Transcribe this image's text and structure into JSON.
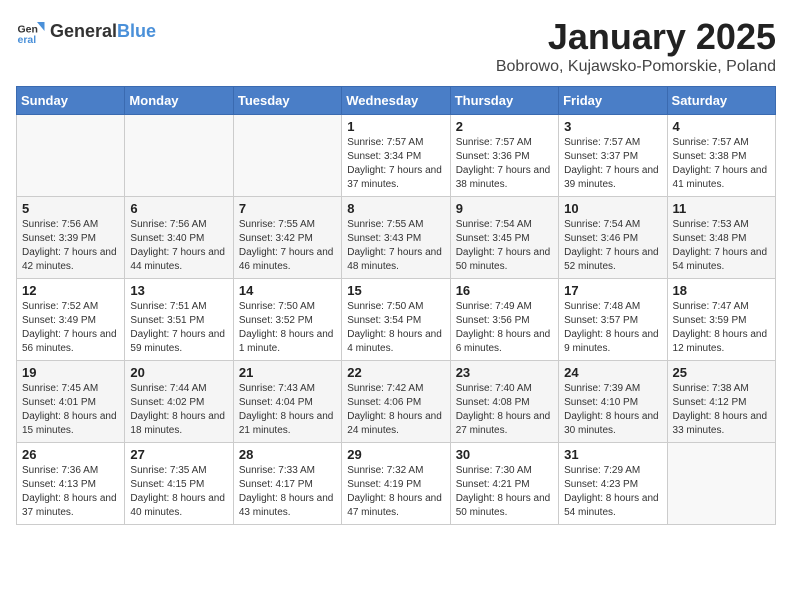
{
  "header": {
    "logo_general": "General",
    "logo_blue": "Blue",
    "month_title": "January 2025",
    "location": "Bobrowo, Kujawsko-Pomorskie, Poland"
  },
  "weekdays": [
    "Sunday",
    "Monday",
    "Tuesday",
    "Wednesday",
    "Thursday",
    "Friday",
    "Saturday"
  ],
  "weeks": [
    [
      {
        "day": "",
        "info": ""
      },
      {
        "day": "",
        "info": ""
      },
      {
        "day": "",
        "info": ""
      },
      {
        "day": "1",
        "info": "Sunrise: 7:57 AM\nSunset: 3:34 PM\nDaylight: 7 hours and 37 minutes."
      },
      {
        "day": "2",
        "info": "Sunrise: 7:57 AM\nSunset: 3:36 PM\nDaylight: 7 hours and 38 minutes."
      },
      {
        "day": "3",
        "info": "Sunrise: 7:57 AM\nSunset: 3:37 PM\nDaylight: 7 hours and 39 minutes."
      },
      {
        "day": "4",
        "info": "Sunrise: 7:57 AM\nSunset: 3:38 PM\nDaylight: 7 hours and 41 minutes."
      }
    ],
    [
      {
        "day": "5",
        "info": "Sunrise: 7:56 AM\nSunset: 3:39 PM\nDaylight: 7 hours and 42 minutes."
      },
      {
        "day": "6",
        "info": "Sunrise: 7:56 AM\nSunset: 3:40 PM\nDaylight: 7 hours and 44 minutes."
      },
      {
        "day": "7",
        "info": "Sunrise: 7:55 AM\nSunset: 3:42 PM\nDaylight: 7 hours and 46 minutes."
      },
      {
        "day": "8",
        "info": "Sunrise: 7:55 AM\nSunset: 3:43 PM\nDaylight: 7 hours and 48 minutes."
      },
      {
        "day": "9",
        "info": "Sunrise: 7:54 AM\nSunset: 3:45 PM\nDaylight: 7 hours and 50 minutes."
      },
      {
        "day": "10",
        "info": "Sunrise: 7:54 AM\nSunset: 3:46 PM\nDaylight: 7 hours and 52 minutes."
      },
      {
        "day": "11",
        "info": "Sunrise: 7:53 AM\nSunset: 3:48 PM\nDaylight: 7 hours and 54 minutes."
      }
    ],
    [
      {
        "day": "12",
        "info": "Sunrise: 7:52 AM\nSunset: 3:49 PM\nDaylight: 7 hours and 56 minutes."
      },
      {
        "day": "13",
        "info": "Sunrise: 7:51 AM\nSunset: 3:51 PM\nDaylight: 7 hours and 59 minutes."
      },
      {
        "day": "14",
        "info": "Sunrise: 7:50 AM\nSunset: 3:52 PM\nDaylight: 8 hours and 1 minute."
      },
      {
        "day": "15",
        "info": "Sunrise: 7:50 AM\nSunset: 3:54 PM\nDaylight: 8 hours and 4 minutes."
      },
      {
        "day": "16",
        "info": "Sunrise: 7:49 AM\nSunset: 3:56 PM\nDaylight: 8 hours and 6 minutes."
      },
      {
        "day": "17",
        "info": "Sunrise: 7:48 AM\nSunset: 3:57 PM\nDaylight: 8 hours and 9 minutes."
      },
      {
        "day": "18",
        "info": "Sunrise: 7:47 AM\nSunset: 3:59 PM\nDaylight: 8 hours and 12 minutes."
      }
    ],
    [
      {
        "day": "19",
        "info": "Sunrise: 7:45 AM\nSunset: 4:01 PM\nDaylight: 8 hours and 15 minutes."
      },
      {
        "day": "20",
        "info": "Sunrise: 7:44 AM\nSunset: 4:02 PM\nDaylight: 8 hours and 18 minutes."
      },
      {
        "day": "21",
        "info": "Sunrise: 7:43 AM\nSunset: 4:04 PM\nDaylight: 8 hours and 21 minutes."
      },
      {
        "day": "22",
        "info": "Sunrise: 7:42 AM\nSunset: 4:06 PM\nDaylight: 8 hours and 24 minutes."
      },
      {
        "day": "23",
        "info": "Sunrise: 7:40 AM\nSunset: 4:08 PM\nDaylight: 8 hours and 27 minutes."
      },
      {
        "day": "24",
        "info": "Sunrise: 7:39 AM\nSunset: 4:10 PM\nDaylight: 8 hours and 30 minutes."
      },
      {
        "day": "25",
        "info": "Sunrise: 7:38 AM\nSunset: 4:12 PM\nDaylight: 8 hours and 33 minutes."
      }
    ],
    [
      {
        "day": "26",
        "info": "Sunrise: 7:36 AM\nSunset: 4:13 PM\nDaylight: 8 hours and 37 minutes."
      },
      {
        "day": "27",
        "info": "Sunrise: 7:35 AM\nSunset: 4:15 PM\nDaylight: 8 hours and 40 minutes."
      },
      {
        "day": "28",
        "info": "Sunrise: 7:33 AM\nSunset: 4:17 PM\nDaylight: 8 hours and 43 minutes."
      },
      {
        "day": "29",
        "info": "Sunrise: 7:32 AM\nSunset: 4:19 PM\nDaylight: 8 hours and 47 minutes."
      },
      {
        "day": "30",
        "info": "Sunrise: 7:30 AM\nSunset: 4:21 PM\nDaylight: 8 hours and 50 minutes."
      },
      {
        "day": "31",
        "info": "Sunrise: 7:29 AM\nSunset: 4:23 PM\nDaylight: 8 hours and 54 minutes."
      },
      {
        "day": "",
        "info": ""
      }
    ]
  ]
}
